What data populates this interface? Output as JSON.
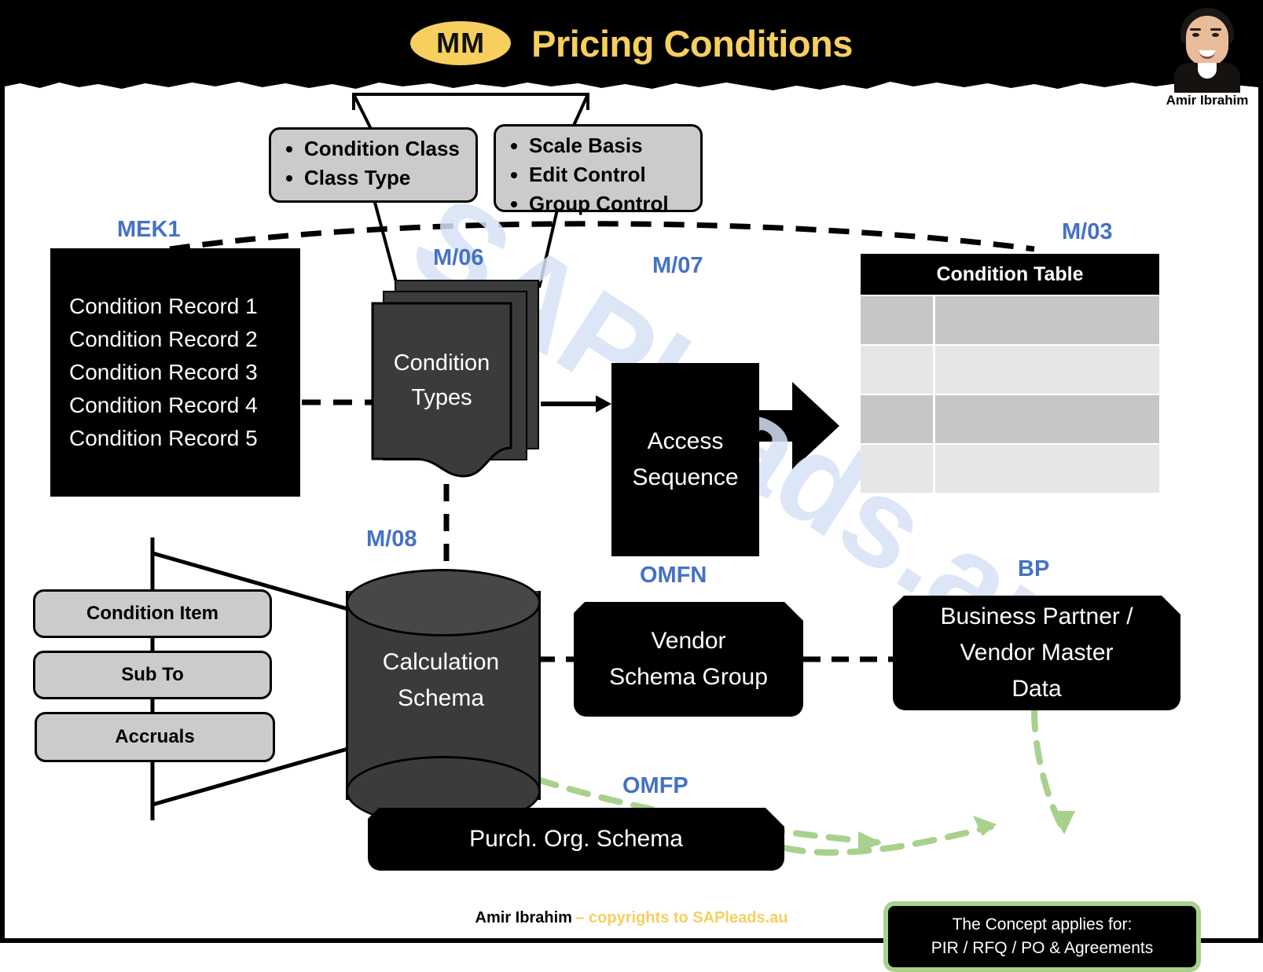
{
  "header": {
    "badge": "MM",
    "title": "Pricing Conditions",
    "author": "Amir Ibrahim"
  },
  "colors": {
    "accent_yellow": "#F7CF5E",
    "code_blue": "#4472C4",
    "green": "#A9D18E",
    "gray_box": "#CBCBCB",
    "dark_doc": "#3B3B3B",
    "watermark": "#D6E2F5"
  },
  "watermark": "SAPleads.au",
  "attribute_boxes": [
    {
      "name": "condition-class-box",
      "items": [
        "Condition Class",
        "Class Type"
      ]
    },
    {
      "name": "control-box",
      "items": [
        "Scale Basis",
        "Edit Control",
        "Group Control"
      ]
    }
  ],
  "tcodes": {
    "mek1": "MEK1",
    "m06": "M/06",
    "m07": "M/07",
    "m03": "M/03",
    "m08": "M/08",
    "omfn": "OMFN",
    "bp": "BP",
    "omfp": "OMFP"
  },
  "condition_records": [
    "Condition Record 1",
    "Condition Record 2",
    "Condition Record 3",
    "Condition Record 4",
    "Condition Record 5"
  ],
  "condition_types": {
    "line1": "Condition",
    "line2": "Types"
  },
  "access_sequence": {
    "line1": "Access",
    "line2": "Sequence"
  },
  "condition_table": {
    "title": "Condition Table",
    "rows": [
      {
        "style": "rowA",
        "c1": "",
        "c2": ""
      },
      {
        "style": "rowB",
        "c1": "",
        "c2": ""
      },
      {
        "style": "rowA",
        "c1": "",
        "c2": ""
      },
      {
        "style": "rowB",
        "c1": "",
        "c2": ""
      }
    ]
  },
  "calculation_schema": {
    "line1": "Calculation",
    "line2": "Schema"
  },
  "schema_steps": [
    "Condition Item",
    "Sub To",
    "Accruals"
  ],
  "vendor_schema_group": {
    "line1": "Vendor",
    "line2": "Schema Group"
  },
  "business_partner": {
    "line1": "Business Partner /",
    "line2": "Vendor Master",
    "line3": "Data"
  },
  "purch_org_schema": {
    "line1": "Purch. Org. Schema"
  },
  "concept_note": {
    "line1": "The Concept applies for:",
    "line2": "PIR / RFQ / PO & Agreements"
  },
  "footer": {
    "name": "Amir Ibrahim",
    "copyright": "– copyrights to SAPleads.au"
  }
}
